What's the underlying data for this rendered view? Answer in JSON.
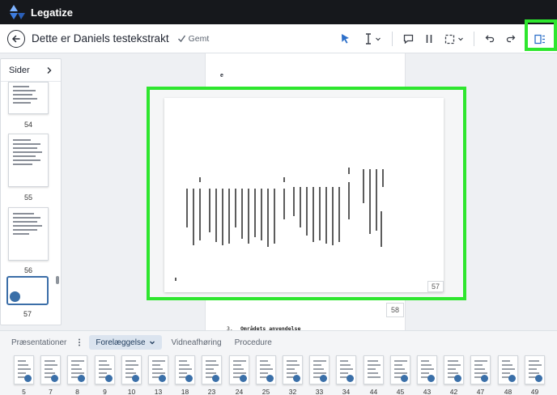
{
  "app": {
    "name": "Legatize"
  },
  "toolbar": {
    "title": "Dette er Daniels testekstrakt",
    "saved": "Gemt"
  },
  "sidebar": {
    "header": "Sider",
    "pages": [
      "54",
      "55",
      "56",
      "57"
    ],
    "selected_page": "57"
  },
  "document": {
    "current_page_label": "57",
    "next_page_label": "58",
    "section_fragment": "3.",
    "section_heading": "Områdets anvendelse",
    "top_page_char": "e"
  },
  "bottom": {
    "tabs": [
      "Præsentationer",
      "Forelæggelse",
      "Vidneafhøring",
      "Procedure"
    ],
    "active_tab": "Forelæggelse",
    "pages": [
      "5",
      "7",
      "8",
      "9",
      "10",
      "13",
      "18",
      "23",
      "24",
      "25",
      "32",
      "33",
      "34",
      "44",
      "45",
      "43",
      "42",
      "47",
      "48",
      "49"
    ]
  },
  "colors": {
    "highlight": "#2ee62e",
    "accent": "#3a6fa8",
    "appbar": "#16181c"
  }
}
